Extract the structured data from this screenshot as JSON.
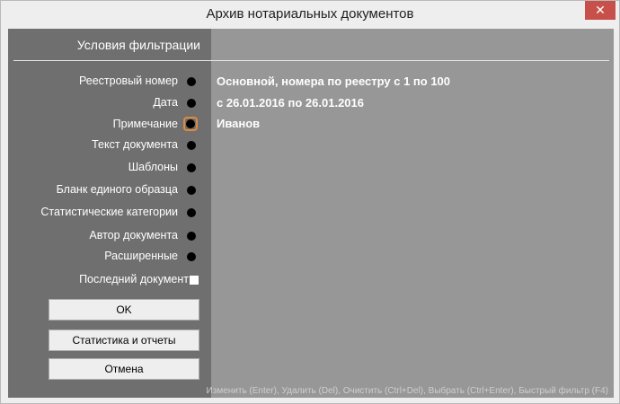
{
  "window": {
    "title": "Архив нотариальных документов",
    "close_glyph": "✕"
  },
  "left_panel": {
    "title": "Условия фильтрации",
    "filters": [
      {
        "label": "Реестровый номер"
      },
      {
        "label": "Дата"
      },
      {
        "label": "Примечание",
        "focused": true
      },
      {
        "label": "Текст документа"
      },
      {
        "label": "Шаблоны"
      },
      {
        "label": "Бланк единого образца"
      },
      {
        "label": "Статистические категории"
      },
      {
        "label": "Автор документа"
      },
      {
        "label": "Расширенные"
      }
    ],
    "last_document": {
      "label": "Последний документ",
      "checked": false
    },
    "buttons": {
      "ok": "OK",
      "stats": "Статистика и отчеты",
      "cancel": "Отмена"
    }
  },
  "right_panel": {
    "values": [
      "Основной, номера по реестру с 1 по 100",
      "с 26.01.2016 по 26.01.2016",
      "Иванов"
    ],
    "hint": "Изменить (Enter), Удалить (Del), Очистить (Ctrl+Del), Выбрать (Ctrl+Enter), Быстрый фильтр (F4)"
  },
  "colors": {
    "left_panel_bg": "#6f6f6f",
    "right_panel_bg": "#979797",
    "close_button_bg": "#c7504a",
    "focus_ring": "#e08a3c"
  }
}
